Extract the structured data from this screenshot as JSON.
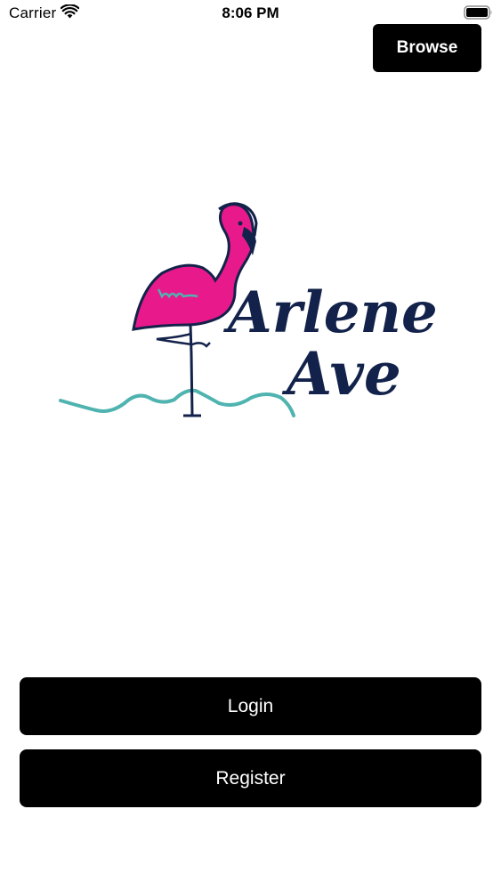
{
  "status_bar": {
    "carrier": "Carrier",
    "time": "8:06 PM",
    "icons": [
      "wifi-icon",
      "battery-icon"
    ]
  },
  "header": {
    "browse_label": "Browse"
  },
  "logo": {
    "line1": "Arlene",
    "line2": "Ave",
    "colors": {
      "flamingo": "#e8198b",
      "outline": "#13224a",
      "water": "#4fb3b0"
    }
  },
  "actions": {
    "login_label": "Login",
    "register_label": "Register"
  },
  "colors": {
    "button_bg": "#000000",
    "button_text": "#ffffff",
    "background": "#ffffff"
  }
}
